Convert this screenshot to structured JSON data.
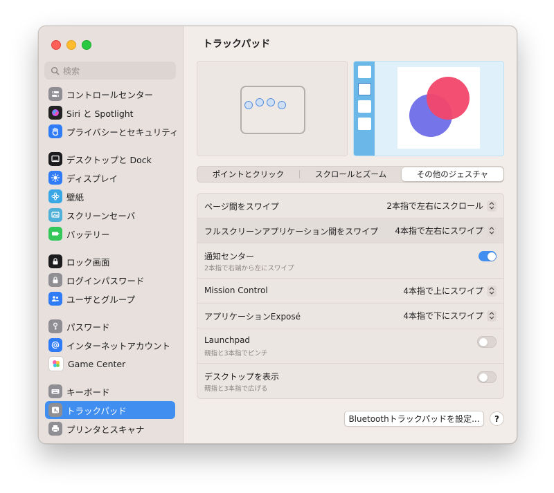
{
  "search": {
    "placeholder": "検索"
  },
  "sidebar": {
    "items": [
      {
        "label": "コントロールセンター",
        "icon": "control-center-icon",
        "color": "#8e8e93"
      },
      {
        "label": "Siri と Spotlight",
        "icon": "siri-icon",
        "color": "#222222"
      },
      {
        "label": "プライバシーとセキュリティ",
        "icon": "hand-icon",
        "color": "#2f7cf6"
      },
      {
        "label": "デスクトップと Dock",
        "icon": "desktop-dock-icon",
        "color": "#1c1c1e"
      },
      {
        "label": "ディスプレイ",
        "icon": "display-icon",
        "color": "#2f7cf6"
      },
      {
        "label": "壁紙",
        "icon": "wallpaper-icon",
        "color": "#39a6e6"
      },
      {
        "label": "スクリーンセーバ",
        "icon": "screensaver-icon",
        "color": "#4fb0d8"
      },
      {
        "label": "バッテリー",
        "icon": "battery-icon",
        "color": "#34c759"
      },
      {
        "label": "ロック画面",
        "icon": "lock-screen-icon",
        "color": "#1c1c1e"
      },
      {
        "label": "ログインパスワード",
        "icon": "lock-icon",
        "color": "#8e8e93"
      },
      {
        "label": "ユーザとグループ",
        "icon": "users-icon",
        "color": "#2f7cf6"
      },
      {
        "label": "パスワード",
        "icon": "key-icon",
        "color": "#8e8e93"
      },
      {
        "label": "インターネットアカウント",
        "icon": "at-icon",
        "color": "#2f7cf6"
      },
      {
        "label": "Game Center",
        "icon": "game-center-icon",
        "color": "#ffffff"
      },
      {
        "label": "キーボード",
        "icon": "keyboard-icon",
        "color": "#8e8e93"
      },
      {
        "label": "トラックパッド",
        "icon": "trackpad-icon",
        "color": "#8e8e93",
        "selected": true
      },
      {
        "label": "プリンタとスキャナ",
        "icon": "printer-icon",
        "color": "#8e8e93"
      }
    ]
  },
  "main": {
    "title": "トラックパッド",
    "tabs": [
      {
        "label": "ポイントとクリック"
      },
      {
        "label": "スクロールとズーム"
      },
      {
        "label": "その他のジェスチャ",
        "selected": true
      }
    ],
    "rows": [
      {
        "label": "ページ間をスワイプ",
        "value": "2本指で左右にスクロール",
        "control": "popup"
      },
      {
        "label": "フルスクリーンアプリケーション間をスワイプ",
        "value": "4本指で左右にスワイプ",
        "control": "popup",
        "highlighted": true
      },
      {
        "label": "通知センター",
        "sub": "2本指で右端から左にスワイプ",
        "control": "toggle",
        "on": true
      },
      {
        "label": "Mission Control",
        "value": "4本指で上にスワイプ",
        "control": "popup"
      },
      {
        "label": "アプリケーションExposé",
        "value": "4本指で下にスワイプ",
        "control": "popup"
      },
      {
        "label": "Launchpad",
        "sub": "親指と3本指でピンチ",
        "control": "toggle",
        "on": false
      },
      {
        "label": "デスクトップを表示",
        "sub": "親指と3本指で広げる",
        "control": "toggle",
        "on": false
      }
    ],
    "bluetooth_button": "Bluetoothトラックパッドを設定...",
    "help_button": "?"
  },
  "colors": {
    "accent": "#3f8ef0",
    "window_bg": "#f3ede9",
    "sidebar_bg": "#e7e0dc"
  }
}
